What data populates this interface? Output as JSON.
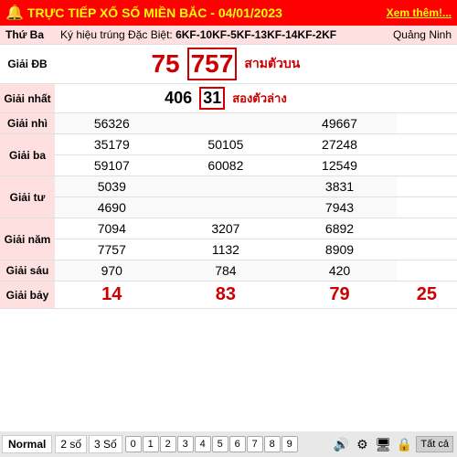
{
  "header": {
    "title": "TRỰC TIẾP XỔ SỐ MIỀN BẮC - 04/01/2023",
    "see_more": "Xem thêm!...",
    "bell": "🔔"
  },
  "special_row": {
    "label": "Thứ Ba",
    "prefix": "Ký hiệu trúng Đặc Biệt:",
    "values": "6KF-10KF-5KF-13KF-14KF-2KF",
    "province": "Quảng Ninh"
  },
  "prizes": {
    "db": {
      "label": "Giải ĐB",
      "value_prefix": "75",
      "value_highlighted": "757",
      "annotation": "สามตัวบน"
    },
    "first": {
      "label": "Giải nhất",
      "value_prefix": "406",
      "value_highlighted": "31",
      "annotation": "สองตัวล่าง"
    },
    "second": {
      "label": "Giải nhì",
      "values": [
        "56326",
        "49667"
      ]
    },
    "third": {
      "label": "Giải ba",
      "row1": [
        "35179",
        "50105",
        "27248"
      ],
      "row2": [
        "59107",
        "60082",
        "12549"
      ]
    },
    "fourth": {
      "label": "Giải tư",
      "row1": [
        "5039",
        "",
        "3831"
      ],
      "row2": [
        "4690",
        "",
        "7943"
      ]
    },
    "fifth": {
      "label": "Giải năm",
      "row1": [
        "7094",
        "3207",
        "6892"
      ],
      "row2": [
        "7757",
        "1132",
        "8909"
      ]
    },
    "sixth": {
      "label": "Giải sáu",
      "values": [
        "970",
        "784",
        "420"
      ]
    },
    "seventh": {
      "label": "Giải bảy",
      "values": [
        "14",
        "83",
        "79",
        "25"
      ]
    }
  },
  "bottom": {
    "normal": "Normal",
    "tab1": "2 số",
    "tab2": "3 Số",
    "numbers": [
      "0",
      "1",
      "2",
      "3",
      "4",
      "5",
      "6",
      "7",
      "8",
      "9"
    ],
    "icons": [
      "🔊",
      "⚙",
      "🖥",
      "🔒"
    ],
    "tatca": "Tất cả"
  }
}
